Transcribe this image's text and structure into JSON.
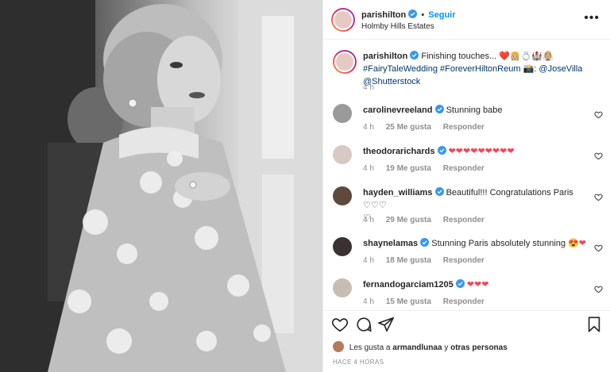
{
  "header": {
    "username": "parishilton",
    "dot": "•",
    "follow_label": "Seguir",
    "location": "Holmby Hills Estates",
    "more_icon": "more-dots-icon"
  },
  "caption": {
    "username": "parishilton",
    "text": "Finishing touches...",
    "emojis": "❤️👸🏼💍🏰👰🏼‍♀️",
    "tag1": "#FairyTaleWedding",
    "tag2": "#ForeverHiltonReum",
    "camera": "📸",
    "credit_sep": ":",
    "mention1": "@JoseVilla",
    "mention2": "@Shutterstock",
    "time": "4 h"
  },
  "comments": [
    {
      "username": "carolinevreeland",
      "verified": true,
      "text": "Stunning babe",
      "time": "4 h",
      "likes": "25 Me gusta",
      "reply": "Responder",
      "avatar_color": "#9a9a9a"
    },
    {
      "username": "theodorarichards",
      "verified": true,
      "text": "❤❤❤❤❤❤❤❤❤",
      "time": "4 h",
      "likes": "19 Me gusta",
      "reply": "Responder",
      "avatar_color": "#d8c9c4"
    },
    {
      "username": "hayden_williams",
      "verified": true,
      "text": "Beautiful!!! Congratulations Paris ♡♡♡",
      "text2": "♡",
      "time": "4 h",
      "likes": "29 Me gusta",
      "reply": "Responder",
      "avatar_color": "#5e4a3c"
    },
    {
      "username": "shaynelamas",
      "verified": true,
      "text": "Stunning Paris absolutely stunning",
      "emoji": "😍❤",
      "time": "4 h",
      "likes": "18 Me gusta",
      "reply": "Responder",
      "avatar_color": "#3a3230"
    },
    {
      "username": "fernandogarciam1205",
      "verified": true,
      "text": "❤❤❤",
      "time": "4 h",
      "likes": "15 Me gusta",
      "reply": "Responder",
      "avatar_color": "#c7bdb4"
    }
  ],
  "actions": {
    "like_icon": "heart-icon",
    "comment_icon": "comment-icon",
    "share_icon": "share-icon",
    "save_icon": "bookmark-icon"
  },
  "likes": {
    "prefix": "Les gusta a",
    "user": "armandlunaa",
    "suffix": "y",
    "others": "otras personas"
  },
  "time_ago": "HACE 4 HORAS",
  "colors": {
    "link": "#0095f6",
    "heart": "#ed4956",
    "muted": "#8e8e8e",
    "hashtag": "#00376b"
  }
}
